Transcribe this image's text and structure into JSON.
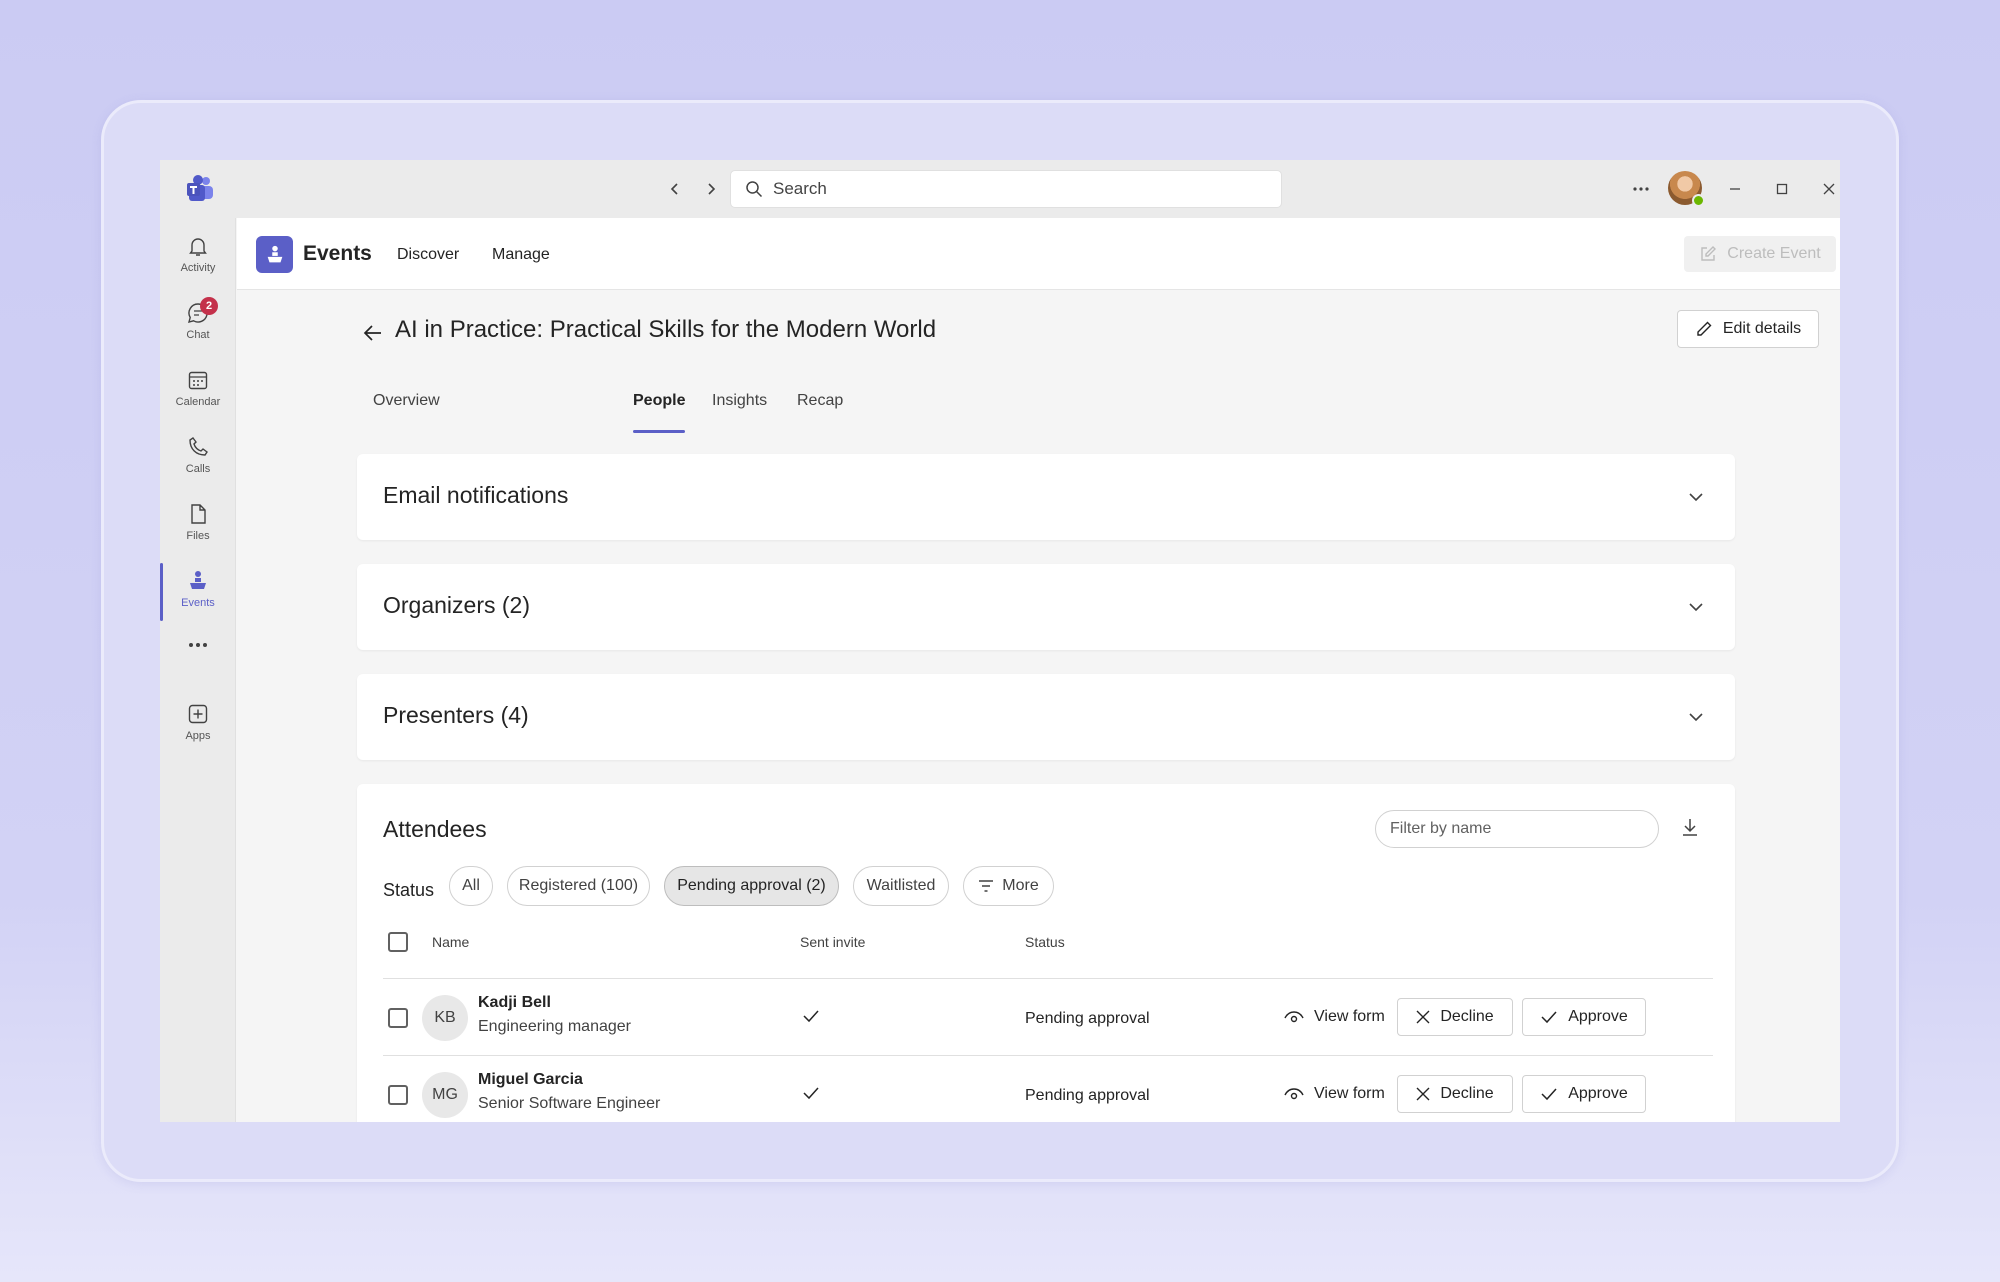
{
  "titlebar": {
    "search_placeholder": "Search"
  },
  "rail": {
    "items": [
      {
        "label": "Activity",
        "icon": "bell-icon"
      },
      {
        "label": "Chat",
        "icon": "chat-icon",
        "badge": "2"
      },
      {
        "label": "Calendar",
        "icon": "calendar-icon"
      },
      {
        "label": "Calls",
        "icon": "phone-icon"
      },
      {
        "label": "Files",
        "icon": "file-icon"
      },
      {
        "label": "Events",
        "icon": "events-icon",
        "active": true
      },
      {
        "label": "Apps",
        "icon": "add-app-icon"
      }
    ]
  },
  "appbar": {
    "app_name": "Events",
    "nav": [
      "Discover",
      "Manage"
    ],
    "create_label": "Create Event"
  },
  "page": {
    "title": "AI in Practice: Practical Skills for the Modern World",
    "edit_label": "Edit details",
    "tabs": [
      "Overview",
      "People",
      "Insights",
      "Recap"
    ],
    "active_tab": "People"
  },
  "sections": {
    "email": "Email notifications",
    "organizers": "Organizers (2)",
    "presenters": "Presenters (4)"
  },
  "attendees": {
    "title": "Attendees",
    "filter_placeholder": "Filter by name",
    "status_label": "Status",
    "filters": [
      "All",
      "Registered (100)",
      "Pending approval (2)",
      "Waitlisted",
      "More"
    ],
    "selected_filter": "Pending approval (2)",
    "columns": [
      "Name",
      "Sent invite",
      "Status"
    ],
    "rows": [
      {
        "initials": "KB",
        "name": "Kadji Bell",
        "role": "Engineering manager",
        "sent_invite": true,
        "status": "Pending approval"
      },
      {
        "initials": "MG",
        "name": "Miguel Garcia",
        "role": "Senior Software Engineer",
        "sent_invite": true,
        "status": "Pending approval"
      }
    ],
    "actions": {
      "view": "View form",
      "decline": "Decline",
      "approve": "Approve"
    }
  },
  "colors": {
    "accent": "#5b5fc7",
    "badge": "#c4314b",
    "presence": "#6bb700"
  }
}
